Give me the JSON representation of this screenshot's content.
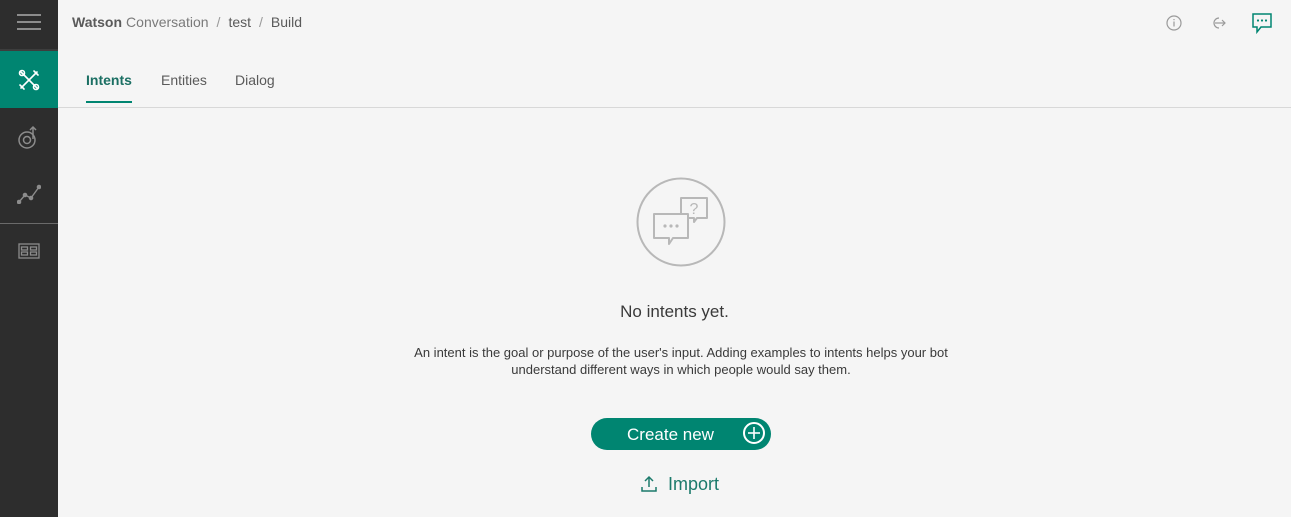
{
  "breadcrumb": {
    "brand": "Watson",
    "product": "Conversation",
    "separator": "/",
    "workspace": "test",
    "page": "Build"
  },
  "sidebar": {
    "items": [
      {
        "name": "menu-icon"
      },
      {
        "name": "build-icon",
        "active": true
      },
      {
        "name": "improve-icon"
      },
      {
        "name": "analytics-icon"
      },
      {
        "name": "catalog-icon"
      }
    ]
  },
  "header_icons": [
    "info-icon",
    "logout-icon",
    "chat-icon"
  ],
  "tabs": [
    {
      "label": "Intents",
      "active": true
    },
    {
      "label": "Entities"
    },
    {
      "label": "Dialog"
    }
  ],
  "empty_state": {
    "title": "No intents yet.",
    "description_line1": "An intent is the goal or purpose of the user's input. Adding examples to intents helps your bot",
    "description_line2": "understand different ways in which people would say them.",
    "create_label": "Create new",
    "import_label": "Import"
  },
  "colors": {
    "accent": "#008571",
    "sidebar": "#2d2d2d",
    "background": "#f5f5f5"
  }
}
